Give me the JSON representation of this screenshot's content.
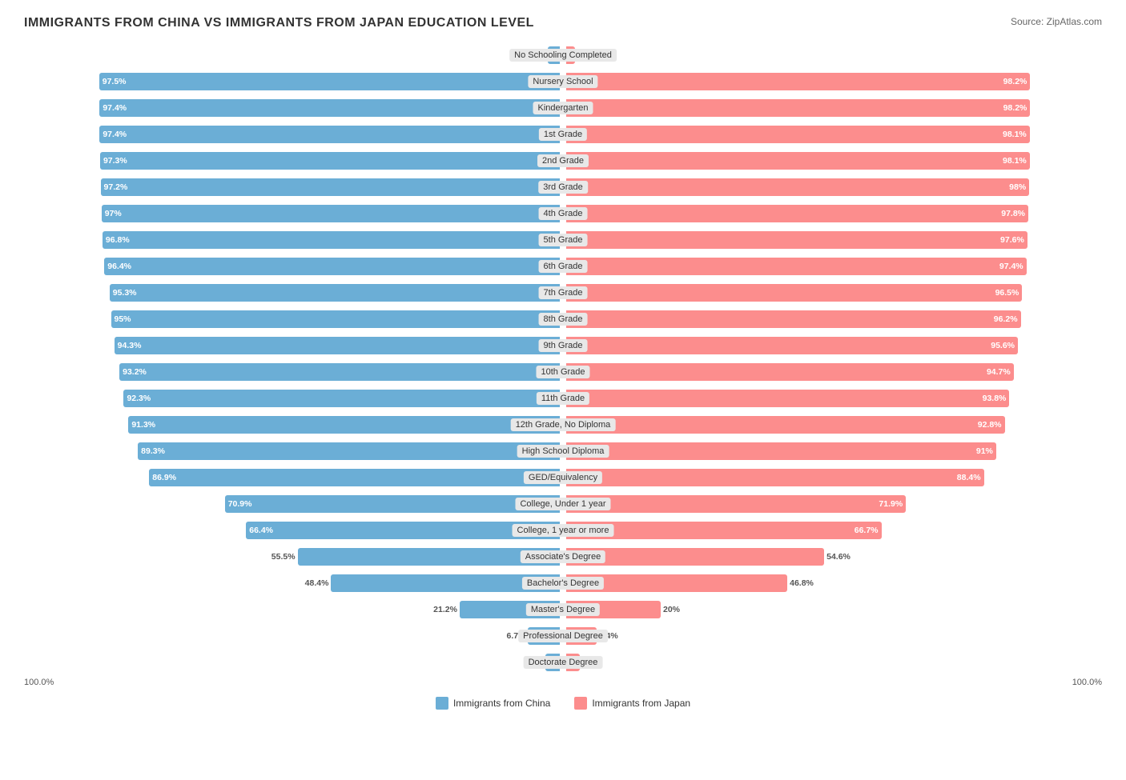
{
  "title": "IMMIGRANTS FROM CHINA VS IMMIGRANTS FROM JAPAN EDUCATION LEVEL",
  "source": "Source: ZipAtlas.com",
  "china_color": "#6baed6",
  "japan_color": "#fc8d8d",
  "legend": {
    "china": "Immigrants from China",
    "japan": "Immigrants from Japan"
  },
  "rows": [
    {
      "label": "No Schooling Completed",
      "china": 2.6,
      "japan": 1.9,
      "china_inside": false,
      "japan_inside": false
    },
    {
      "label": "Nursery School",
      "china": 97.5,
      "japan": 98.2,
      "china_inside": true,
      "japan_inside": true
    },
    {
      "label": "Kindergarten",
      "china": 97.4,
      "japan": 98.2,
      "china_inside": true,
      "japan_inside": true
    },
    {
      "label": "1st Grade",
      "china": 97.4,
      "japan": 98.1,
      "china_inside": true,
      "japan_inside": true
    },
    {
      "label": "2nd Grade",
      "china": 97.3,
      "japan": 98.1,
      "china_inside": true,
      "japan_inside": true
    },
    {
      "label": "3rd Grade",
      "china": 97.2,
      "japan": 98.0,
      "china_inside": true,
      "japan_inside": true
    },
    {
      "label": "4th Grade",
      "china": 97.0,
      "japan": 97.8,
      "china_inside": true,
      "japan_inside": true
    },
    {
      "label": "5th Grade",
      "china": 96.8,
      "japan": 97.6,
      "china_inside": true,
      "japan_inside": true
    },
    {
      "label": "6th Grade",
      "china": 96.4,
      "japan": 97.4,
      "china_inside": true,
      "japan_inside": true
    },
    {
      "label": "7th Grade",
      "china": 95.3,
      "japan": 96.5,
      "china_inside": true,
      "japan_inside": true
    },
    {
      "label": "8th Grade",
      "china": 95.0,
      "japan": 96.2,
      "china_inside": true,
      "japan_inside": true
    },
    {
      "label": "9th Grade",
      "china": 94.3,
      "japan": 95.6,
      "china_inside": true,
      "japan_inside": true
    },
    {
      "label": "10th Grade",
      "china": 93.2,
      "japan": 94.7,
      "china_inside": true,
      "japan_inside": true
    },
    {
      "label": "11th Grade",
      "china": 92.3,
      "japan": 93.8,
      "china_inside": true,
      "japan_inside": true
    },
    {
      "label": "12th Grade, No Diploma",
      "china": 91.3,
      "japan": 92.8,
      "china_inside": true,
      "japan_inside": true
    },
    {
      "label": "High School Diploma",
      "china": 89.3,
      "japan": 91.0,
      "china_inside": true,
      "japan_inside": true
    },
    {
      "label": "GED/Equivalency",
      "china": 86.9,
      "japan": 88.4,
      "china_inside": true,
      "japan_inside": true
    },
    {
      "label": "College, Under 1 year",
      "china": 70.9,
      "japan": 71.9,
      "china_inside": true,
      "japan_inside": true
    },
    {
      "label": "College, 1 year or more",
      "china": 66.4,
      "japan": 66.7,
      "china_inside": true,
      "japan_inside": true
    },
    {
      "label": "Associate's Degree",
      "china": 55.5,
      "japan": 54.6,
      "china_inside": false,
      "japan_inside": false
    },
    {
      "label": "Bachelor's Degree",
      "china": 48.4,
      "japan": 46.8,
      "china_inside": false,
      "japan_inside": false
    },
    {
      "label": "Master's Degree",
      "china": 21.2,
      "japan": 20.0,
      "china_inside": false,
      "japan_inside": false
    },
    {
      "label": "Professional Degree",
      "china": 6.7,
      "japan": 6.4,
      "china_inside": false,
      "japan_inside": false
    },
    {
      "label": "Doctorate Degree",
      "china": 3.1,
      "japan": 2.8,
      "china_inside": false,
      "japan_inside": false
    }
  ],
  "axis": {
    "left": "100.0%",
    "right": "100.0%"
  }
}
